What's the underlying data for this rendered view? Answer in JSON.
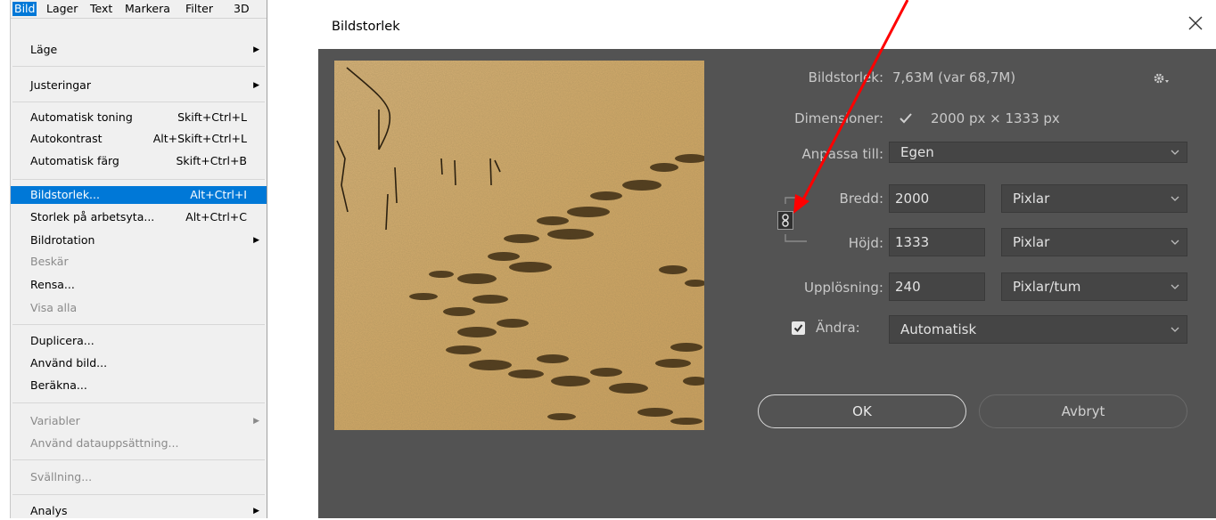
{
  "menu": {
    "menubar": [
      "Bild",
      "Lager",
      "Text",
      "Markera",
      "Filter",
      "3D"
    ],
    "items": [
      {
        "label": "Läge",
        "submenu": true
      },
      {
        "label": "Justeringar",
        "submenu": true
      },
      {
        "label": "Automatisk toning",
        "shortcut": "Skift+Ctrl+L"
      },
      {
        "label": "Autokontrast",
        "shortcut": "Alt+Skift+Ctrl+L"
      },
      {
        "label": "Automatisk färg",
        "shortcut": "Skift+Ctrl+B"
      },
      {
        "label": "Bildstorlek...",
        "shortcut": "Alt+Ctrl+I"
      },
      {
        "label": "Storlek på arbetsyta...",
        "shortcut": "Alt+Ctrl+C"
      },
      {
        "label": "Bildrotation",
        "submenu": true
      },
      {
        "label": "Beskär"
      },
      {
        "label": "Rensa..."
      },
      {
        "label": "Visa alla"
      },
      {
        "label": "Duplicera..."
      },
      {
        "label": "Använd bild..."
      },
      {
        "label": "Beräkna..."
      },
      {
        "label": "Variabler",
        "submenu": true
      },
      {
        "label": "Använd datauppsättning..."
      },
      {
        "label": "Svällning..."
      },
      {
        "label": "Analys",
        "submenu": true
      }
    ]
  },
  "dialog": {
    "title": "Bildstorlek",
    "image_size_label": "Bildstorlek:",
    "image_size_value": "7,63M (var 68,7M)",
    "dimensions_label": "Dimensioner:",
    "dimensions_value": "2000 px  ×  1333 px",
    "fit_to_label": "Anpassa till:",
    "fit_to_value": "Egen",
    "width_label": "Bredd:",
    "width_value": "2000",
    "width_unit": "Pixlar",
    "height_label": "Höjd:",
    "height_value": "1333",
    "height_unit": "Pixlar",
    "resolution_label": "Upplösning:",
    "resolution_value": "240",
    "resolution_unit": "Pixlar/tum",
    "resample_label": "Ändra:",
    "resample_value": "Automatisk",
    "ok_label": "OK",
    "cancel_label": "Avbryt"
  },
  "colors": {
    "dialog_bg": "#535353",
    "field_bg": "#454545",
    "menu_highlight": "#0078d7",
    "annotation_arrow": "#ff0000",
    "sand": "#d2a967"
  }
}
